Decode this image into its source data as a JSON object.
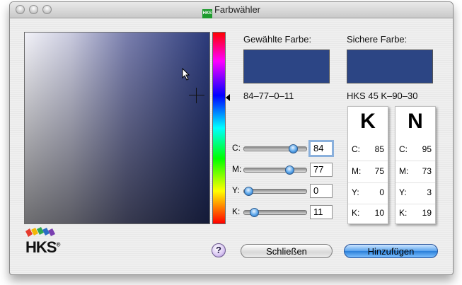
{
  "window": {
    "title": "Farbwähler",
    "badge": "HKS"
  },
  "colors": {
    "selected": "#2c4585",
    "safe": "#2c4584",
    "slider_knob": "#3d8ee0",
    "default_button": "#3f8fe4"
  },
  "chosen": {
    "label": "Gewählte Farbe:",
    "value": "84–77–0–11"
  },
  "safe": {
    "label": "Sichere Farbe:",
    "value": "HKS 45 K–90–30"
  },
  "sliders": [
    {
      "label": "C:",
      "value": "84",
      "fraction": 0.84
    },
    {
      "label": "M:",
      "value": "77",
      "fraction": 0.77
    },
    {
      "label": "Y:",
      "value": "0",
      "fraction": 0.0
    },
    {
      "label": "K:",
      "value": "11",
      "fraction": 0.11
    }
  ],
  "cards": [
    {
      "letter": "K",
      "rows": [
        {
          "k": "C:",
          "v": "85"
        },
        {
          "k": "M:",
          "v": "75"
        },
        {
          "k": "Y:",
          "v": "0"
        },
        {
          "k": "K:",
          "v": "10"
        }
      ]
    },
    {
      "letter": "N",
      "rows": [
        {
          "k": "C:",
          "v": "95"
        },
        {
          "k": "M:",
          "v": "73"
        },
        {
          "k": "Y:",
          "v": "3"
        },
        {
          "k": "K:",
          "v": "19"
        }
      ]
    }
  ],
  "buttons": {
    "help": "?",
    "close": "Schließen",
    "add": "Hinzufügen"
  },
  "logo": {
    "text": "HKS",
    "mark": "®"
  }
}
